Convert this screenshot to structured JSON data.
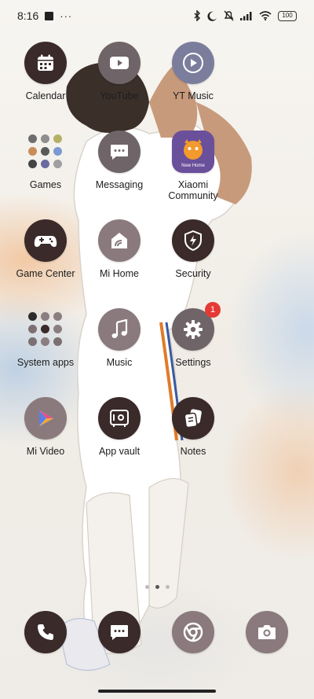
{
  "status_bar": {
    "time": "8:16",
    "more_dots": "···",
    "battery": "100"
  },
  "apps": [
    {
      "label": "Calendar",
      "icon": "calendar-icon"
    },
    {
      "label": "YouTube",
      "icon": "youtube-icon"
    },
    {
      "label": "YT Music",
      "icon": "yt-music-icon"
    },
    {
      "label": "Games",
      "icon": "games-folder-icon"
    },
    {
      "label": "Messaging",
      "icon": "messaging-icon"
    },
    {
      "label": "Xiaomi Community",
      "icon": "xiaomi-community-icon",
      "icon_text": "New Home"
    },
    {
      "label": "Game Center",
      "icon": "gamepad-icon"
    },
    {
      "label": "Mi Home",
      "icon": "mi-home-icon"
    },
    {
      "label": "Security",
      "icon": "security-shield-icon"
    },
    {
      "label": "System apps",
      "icon": "system-apps-folder-icon"
    },
    {
      "label": "Music",
      "icon": "music-note-icon"
    },
    {
      "label": "Settings",
      "icon": "settings-gear-icon",
      "badge": "1"
    },
    {
      "label": "Mi Video",
      "icon": "mi-video-icon"
    },
    {
      "label": "App vault",
      "icon": "app-vault-icon"
    },
    {
      "label": "Notes",
      "icon": "notes-icon"
    }
  ],
  "dock": [
    {
      "name": "phone",
      "icon": "phone-icon"
    },
    {
      "name": "messages",
      "icon": "chat-icon"
    },
    {
      "name": "chrome",
      "icon": "chrome-icon"
    },
    {
      "name": "camera",
      "icon": "camera-icon"
    }
  ],
  "page_indicator": {
    "pages": 3,
    "active": 2
  },
  "colors": {
    "badge": "#e53935",
    "icon_dark": "#3a2a2a",
    "icon_medium": "#6f6468"
  }
}
